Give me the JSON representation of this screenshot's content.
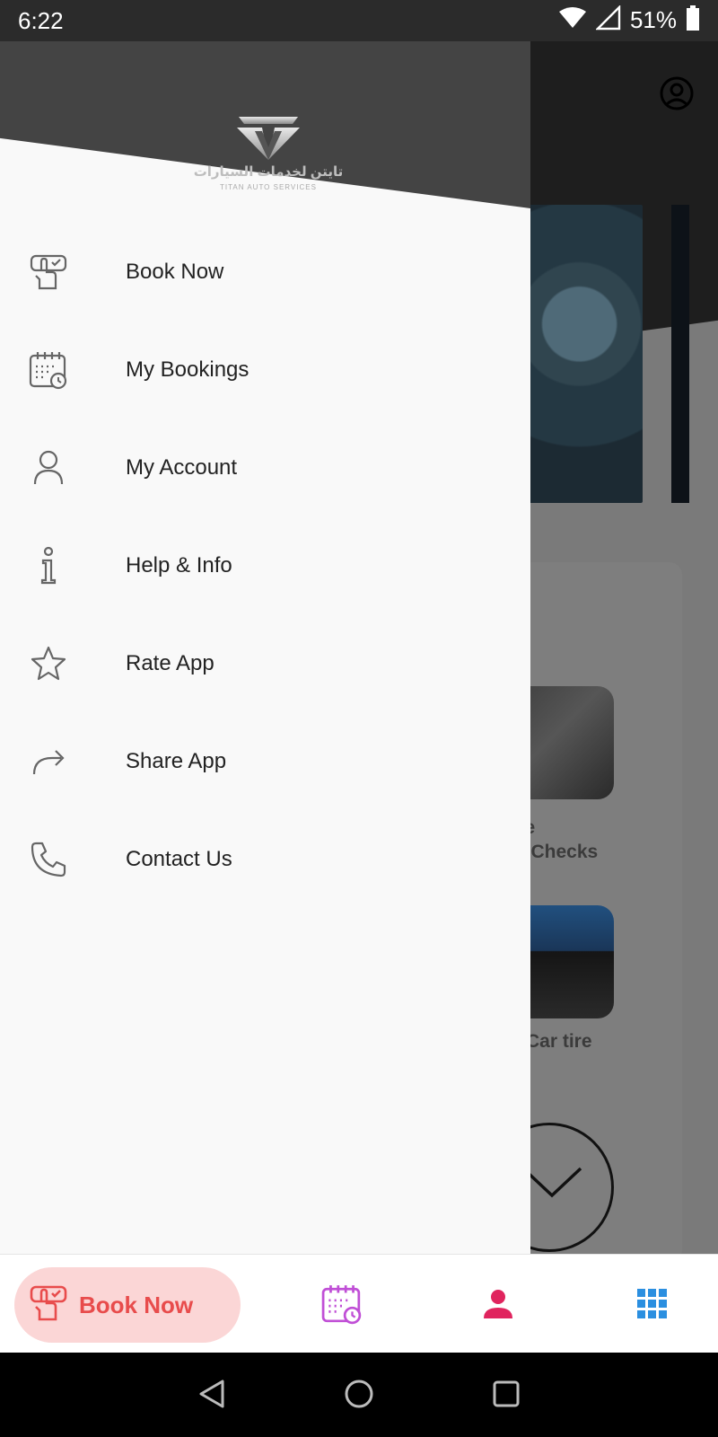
{
  "status_bar": {
    "time": "6:22",
    "battery_percent": "51%",
    "icons": [
      "wifi-icon",
      "signal-icon",
      "battery-icon"
    ]
  },
  "drawer": {
    "logo": {
      "arabic_text": "تايتن لخدمات السيارات",
      "latin_text": "TITAN AUTO SERVICES"
    },
    "menu_items": [
      {
        "label": "Book Now",
        "icon": "book-now-icon"
      },
      {
        "label": "My Bookings",
        "icon": "calendar-icon"
      },
      {
        "label": "My Account",
        "icon": "user-icon"
      },
      {
        "label": "Help & Info",
        "icon": "info-icon"
      },
      {
        "label": "Rate App",
        "icon": "star-icon"
      },
      {
        "label": "Share App",
        "icon": "share-icon"
      },
      {
        "label": "Contact Us",
        "icon": "phone-icon"
      }
    ]
  },
  "background_content": {
    "service_1": {
      "line1": "bile",
      "line2": "on Checks"
    },
    "service_2": {
      "label": "Car tire"
    }
  },
  "bottom_nav": {
    "book_now_label": "Book Now",
    "items": [
      "bookings-calendar-icon",
      "account-icon",
      "apps-grid-icon"
    ]
  },
  "colors": {
    "accent_red": "#e84c4c",
    "pill_bg": "#fbd6d6",
    "calendar_purple": "#c04fd6",
    "account_pink": "#e0245e",
    "grid_blue": "#2b8fe0",
    "drawer_header": "#444444"
  }
}
